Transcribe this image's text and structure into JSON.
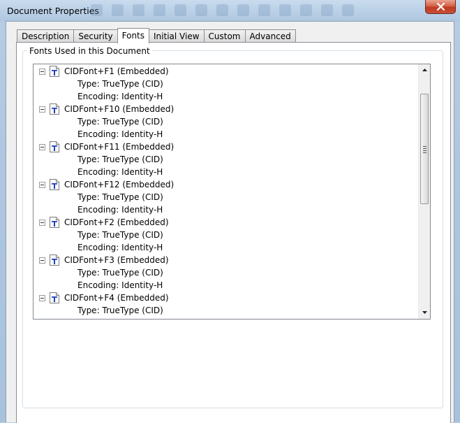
{
  "window": {
    "title": "Document Properties",
    "close_icon": "close-icon"
  },
  "tabs": [
    {
      "label": "Description",
      "active": false
    },
    {
      "label": "Security",
      "active": false
    },
    {
      "label": "Fonts",
      "active": true
    },
    {
      "label": "Initial View",
      "active": false
    },
    {
      "label": "Custom",
      "active": false
    },
    {
      "label": "Advanced",
      "active": false
    }
  ],
  "fonts_group": {
    "title": "Fonts Used in this Document"
  },
  "fonts": [
    {
      "name": "CIDFont+F1 (Embedded)",
      "type": "Type: TrueType (CID)",
      "encoding": "Encoding: Identity-H"
    },
    {
      "name": "CIDFont+F10 (Embedded)",
      "type": "Type: TrueType (CID)",
      "encoding": "Encoding: Identity-H"
    },
    {
      "name": "CIDFont+F11 (Embedded)",
      "type": "Type: TrueType (CID)",
      "encoding": "Encoding: Identity-H"
    },
    {
      "name": "CIDFont+F12 (Embedded)",
      "type": "Type: TrueType (CID)",
      "encoding": "Encoding: Identity-H"
    },
    {
      "name": "CIDFont+F2 (Embedded)",
      "type": "Type: TrueType (CID)",
      "encoding": "Encoding: Identity-H"
    },
    {
      "name": "CIDFont+F3 (Embedded)",
      "type": "Type: TrueType (CID)",
      "encoding": "Encoding: Identity-H"
    },
    {
      "name": "CIDFont+F4 (Embedded)",
      "type": "Type: TrueType (CID)",
      "encoding": null
    }
  ],
  "icons": {
    "font_item": "truetype-font-icon",
    "expander": "collapse-minus-icon"
  },
  "colors": {
    "font_icon_t": "#1f3fbf",
    "close_button": "#c9503a"
  }
}
